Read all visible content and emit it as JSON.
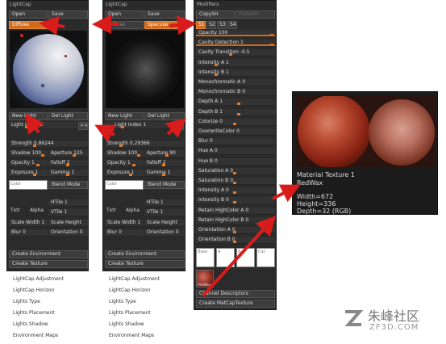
{
  "panel1": {
    "title": "LightCap",
    "open": "Open",
    "save": "Save",
    "mode": "Diffuse",
    "new_light": "New Light",
    "del_light": "Del Light",
    "light_index": "Light Index 1",
    "next": ">>",
    "strength": "Strength 0.86244",
    "shadow": "Shadow 100",
    "aperture": "Aperture 125",
    "opacity": "Opacity 1",
    "falloff": "Falloff 2",
    "exposure": "Exposure 1",
    "gamma": "Gamma 1",
    "color": "Color",
    "blend_mode": "Blend Mode",
    "txtr": "Txtr",
    "alpha": "Alpha",
    "htile": "HTile 1",
    "vtile": "VTile 1",
    "scale_width": "Scale Width 1",
    "scale_height": "Scale Height",
    "blur": "Blur 0",
    "orientation": "Orientation 0",
    "create_env": "Create Environment",
    "create_tex": "Create Texture",
    "list": [
      "LightCap Adjustment",
      "LightCap Horizon",
      "Lights Type",
      "Lights Placement",
      "Lights Shadow",
      "Environment Maps"
    ]
  },
  "panel2": {
    "title": "LightCap",
    "open": "Open",
    "save": "Save",
    "mode_left": "Diffuse",
    "mode": "Specular",
    "new_light": "New Light",
    "del_light": "Del Light",
    "light_index": "Light Index 1",
    "next": ">>",
    "strength": "Strength 0.29366",
    "shadow": "Shadow 100",
    "aperture": "Aperture 90",
    "opacity": "Opacity 1",
    "falloff": "Falloff 2",
    "exposure": "Exposure 1",
    "gamma": "Gamma 1",
    "color": "Color",
    "blend_mode": "Blend Mode",
    "txtr": "Txtr",
    "alpha": "Alpha",
    "htile": "HTile 1",
    "vtile": "VTile 1",
    "scale_width": "Scale Width 1",
    "scale_height": "Scale Height",
    "blur": "Blur 0",
    "orientation": "Orientation 0",
    "create_env": "Create Environment",
    "create_tex": "Create Texture",
    "list": [
      "LightCap Adjustment",
      "LightCap Horizon",
      "Lights Type",
      "Lights Placement",
      "Lights Shadow",
      "Environment Maps"
    ]
  },
  "modifiers": {
    "title": "Modifiers",
    "copy_sh": "CopySH",
    "paste_sh": "PasteSH",
    "tabs": [
      "S1",
      "S2",
      "S3",
      "S4"
    ],
    "rows": [
      {
        "label": "Opacity 100",
        "fill": 1.0
      },
      {
        "label": "Cavity Detection 1",
        "fill": 1.0
      },
      {
        "label": "Cavity Transition -0.5",
        "fill": 0.45
      },
      {
        "label": "Intensity A 1",
        "fill": 0.25
      },
      {
        "label": "Intensity B 1",
        "fill": 0.25
      },
      {
        "label": "Monochromatic A 0",
        "fill": 0
      },
      {
        "label": "Monochromatic B 0",
        "fill": 0
      },
      {
        "label": "Depth A 1",
        "fill": 0.55
      },
      {
        "label": "Depth B 1",
        "fill": 0.55
      },
      {
        "label": "Colorize 0",
        "fill": 0.5
      },
      {
        "label": "OverwriteColor 0",
        "fill": 0
      },
      {
        "label": "Blur 0",
        "fill": 0
      },
      {
        "label": "Hue A 0",
        "fill": 0
      },
      {
        "label": "Hue B 0",
        "fill": 0
      },
      {
        "label": "Saturation A 0",
        "fill": 0.5
      },
      {
        "label": "Saturation B 0",
        "fill": 0.5
      },
      {
        "label": "Intensity A 0",
        "fill": 0.5
      },
      {
        "label": "Intensity B 0",
        "fill": 0.5
      },
      {
        "label": "Retain HighColor A 0",
        "fill": 0
      },
      {
        "label": "Retain HighColor B 0",
        "fill": 0
      },
      {
        "label": "Orientation A 0",
        "fill": 0.5
      },
      {
        "label": "Orientation B 0",
        "fill": 0.5
      }
    ],
    "swatches": [
      "Base",
      "A",
      "B",
      "Cat"
    ],
    "material_label": "RedWax",
    "channel_desc": "Channel Descriptors",
    "create_matcap": "Create MatCapTexture"
  },
  "tooltip": {
    "title": "Material Texture 1",
    "name": "RedWax",
    "width": "Width=672",
    "height": "Height=336",
    "depth": "Depth=32 (RGB)"
  },
  "watermark": {
    "cn": "朱峰社区",
    "url": "ZF3D.COM"
  }
}
